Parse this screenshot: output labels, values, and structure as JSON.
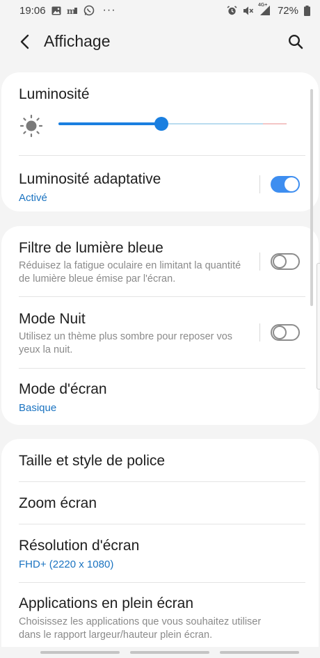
{
  "status_bar": {
    "time": "19:06",
    "more": "···",
    "network": "4G+",
    "battery": "72%",
    "icons_left": [
      "image-icon",
      "m-app-icon",
      "whatsapp-icon"
    ],
    "icons_right": [
      "alarm-icon",
      "mute-icon",
      "signal-icon",
      "battery-icon"
    ]
  },
  "app_bar": {
    "title": "Affichage",
    "back_icon": "back-arrow-icon",
    "search_icon": "search-icon"
  },
  "brightness": {
    "title": "Luminosité",
    "icon": "sun-icon",
    "level_percent": 45
  },
  "adaptive_brightness": {
    "title": "Luminosité adaptative",
    "status": "Activé",
    "enabled": true
  },
  "blue_light_filter": {
    "title": "Filtre de lumière bleue",
    "description": "Réduisez la fatigue oculaire en limitant la quantité de lumière bleue émise par l'écran.",
    "enabled": false
  },
  "night_mode": {
    "title": "Mode Nuit",
    "description": "Utilisez un thème plus sombre pour reposer vos yeux la nuit.",
    "enabled": false
  },
  "screen_mode": {
    "title": "Mode d'écran",
    "value": "Basique"
  },
  "font_size_style": {
    "title": "Taille et style de police"
  },
  "screen_zoom": {
    "title": "Zoom écran"
  },
  "screen_resolution": {
    "title": "Résolution d'écran",
    "value": "FHD+ (2220 x 1080)"
  },
  "fullscreen_apps": {
    "title": "Applications en plein écran",
    "description": "Choisissez les applications que vous souhaitez utiliser dans le rapport largeur/hauteur plein écran."
  },
  "colors": {
    "accent": "#1a7fe0",
    "toggle_on": "#3e8ef0",
    "link_text": "#1a73c1",
    "card_bg": "#ffffff",
    "page_bg": "#f4f4f4"
  }
}
